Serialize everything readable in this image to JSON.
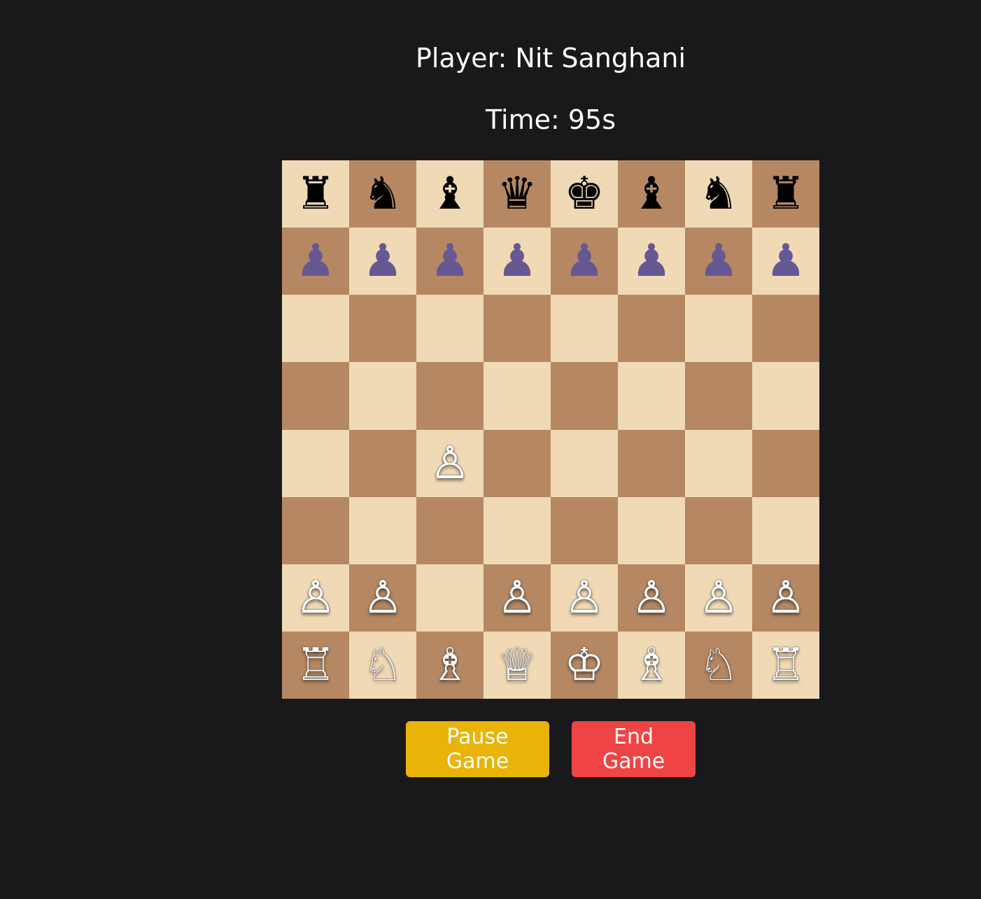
{
  "header": {
    "player_label": "Player: Nit Sanghani",
    "time_label": "Time: 95s"
  },
  "colors": {
    "background": "#19191b",
    "light_square": "#f0d9b5",
    "dark_square": "#b58863",
    "black_piece": "#000000",
    "black_pawn": "#665893",
    "white_piece": "#ffffff",
    "pause_button": "#e9b308",
    "end_button": "#ef4444"
  },
  "board": {
    "rows": [
      [
        {
          "piece": "♜",
          "side": "black",
          "name": "rook"
        },
        {
          "piece": "♞",
          "side": "black",
          "name": "knight"
        },
        {
          "piece": "♝",
          "side": "black",
          "name": "bishop"
        },
        {
          "piece": "♛",
          "side": "black",
          "name": "queen"
        },
        {
          "piece": "♚",
          "side": "black",
          "name": "king"
        },
        {
          "piece": "♝",
          "side": "black",
          "name": "bishop"
        },
        {
          "piece": "♞",
          "side": "black",
          "name": "knight"
        },
        {
          "piece": "♜",
          "side": "black",
          "name": "rook"
        }
      ],
      [
        {
          "piece": "♟",
          "side": "purple",
          "name": "pawn"
        },
        {
          "piece": "♟",
          "side": "purple",
          "name": "pawn"
        },
        {
          "piece": "♟",
          "side": "purple",
          "name": "pawn"
        },
        {
          "piece": "♟",
          "side": "purple",
          "name": "pawn"
        },
        {
          "piece": "♟",
          "side": "purple",
          "name": "pawn"
        },
        {
          "piece": "♟",
          "side": "purple",
          "name": "pawn"
        },
        {
          "piece": "♟",
          "side": "purple",
          "name": "pawn"
        },
        {
          "piece": "♟",
          "side": "purple",
          "name": "pawn"
        }
      ],
      [
        null,
        null,
        null,
        null,
        null,
        null,
        null,
        null
      ],
      [
        null,
        null,
        null,
        null,
        null,
        null,
        null,
        null
      ],
      [
        null,
        null,
        {
          "piece": "♙",
          "side": "white",
          "name": "pawn"
        },
        null,
        null,
        null,
        null,
        null
      ],
      [
        null,
        null,
        null,
        null,
        null,
        null,
        null,
        null
      ],
      [
        {
          "piece": "♙",
          "side": "white",
          "name": "pawn"
        },
        {
          "piece": "♙",
          "side": "white",
          "name": "pawn"
        },
        null,
        {
          "piece": "♙",
          "side": "white",
          "name": "pawn"
        },
        {
          "piece": "♙",
          "side": "white",
          "name": "pawn"
        },
        {
          "piece": "♙",
          "side": "white",
          "name": "pawn"
        },
        {
          "piece": "♙",
          "side": "white",
          "name": "pawn"
        },
        {
          "piece": "♙",
          "side": "white",
          "name": "pawn"
        }
      ],
      [
        {
          "piece": "♖",
          "side": "white",
          "name": "rook"
        },
        {
          "piece": "♘",
          "side": "white",
          "name": "knight"
        },
        {
          "piece": "♗",
          "side": "white",
          "name": "bishop"
        },
        {
          "piece": "♕",
          "side": "white",
          "name": "queen"
        },
        {
          "piece": "♔",
          "side": "white",
          "name": "king"
        },
        {
          "piece": "♗",
          "side": "white",
          "name": "bishop"
        },
        {
          "piece": "♘",
          "side": "white",
          "name": "knight"
        },
        {
          "piece": "♖",
          "side": "white",
          "name": "rook"
        }
      ]
    ]
  },
  "controls": {
    "pause_label": "Pause Game",
    "end_label": "End Game"
  }
}
